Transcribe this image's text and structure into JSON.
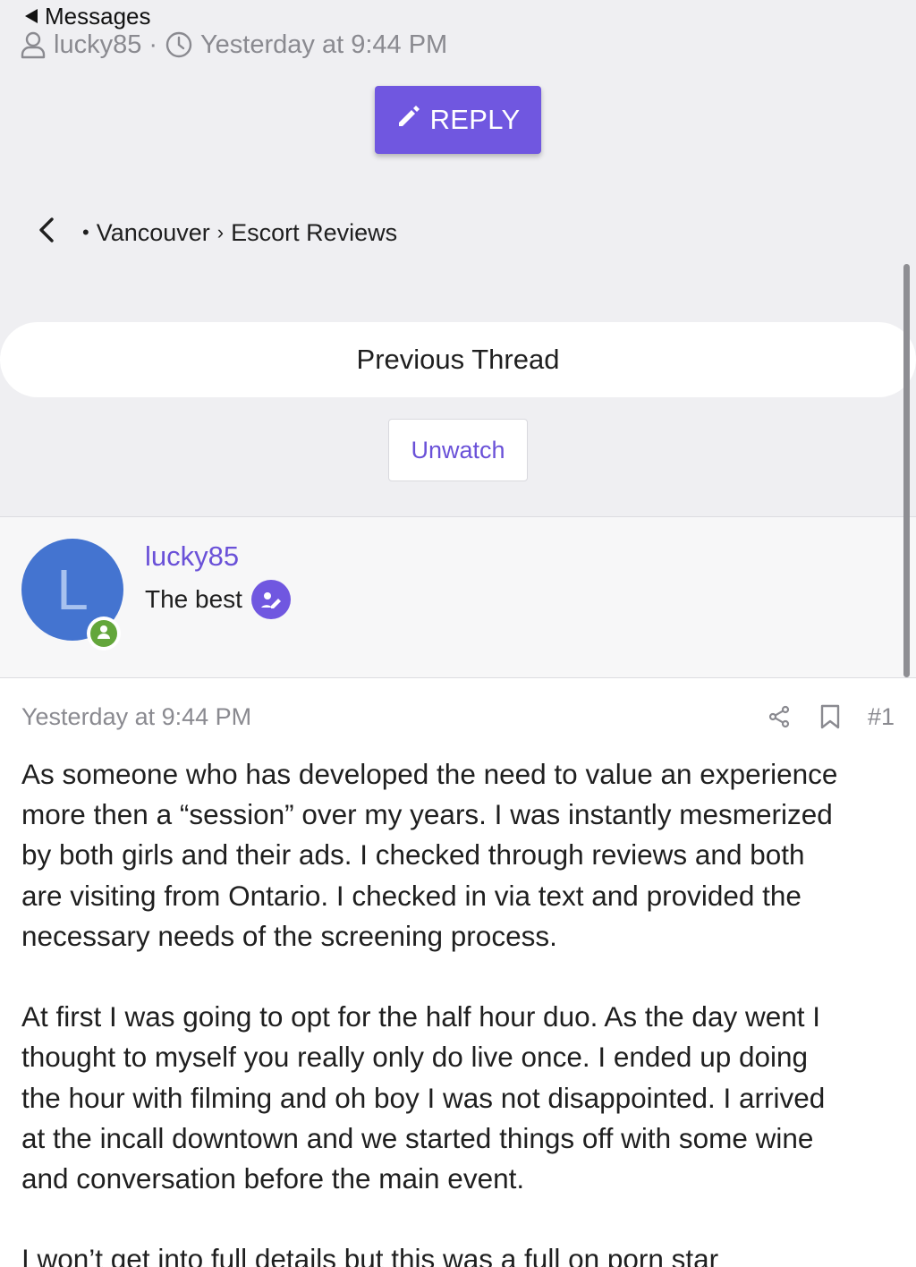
{
  "nav": {
    "back_label": "Messages"
  },
  "thread_meta": {
    "author": "lucky85",
    "separator": "·",
    "timestamp": "Yesterday at 9:44 PM"
  },
  "actions": {
    "reply_label": "REPLY",
    "unwatch_label": "Unwatch",
    "previous_thread_label": "Previous Thread"
  },
  "breadcrumb": {
    "bullet": "•",
    "separator": "›",
    "items": [
      "Vancouver",
      "Escort Reviews"
    ]
  },
  "user": {
    "avatar_letter": "L",
    "name": "lucky85",
    "title": "The best"
  },
  "post": {
    "timestamp": "Yesterday at 9:44 PM",
    "number": "#1",
    "paragraphs": [
      [
        "As someone who has developed the need to value an experience",
        "more then a “session” over my years. I was instantly mesmerized",
        "by both girls and their ads. I checked through reviews and both",
        "are visiting from Ontario. I checked in via text and provided the",
        "necessary needs of the screening process."
      ],
      [
        "At first I was going to opt for the half hour duo. As the day went I",
        "thought to myself you really only do live once. I ended up doing",
        "the hour with filming and oh boy I was not disappointed. I arrived",
        "at the incall downtown and we started things off with some wine",
        "and conversation before the main event."
      ],
      [
        "I won’t get into full details but this was a full on porn star"
      ]
    ]
  },
  "colors": {
    "accent": "#7057e0",
    "link": "#6a51d8",
    "avatar_bg": "#4474d0",
    "online": "#63a63b",
    "page_bg": "#efeff2"
  }
}
